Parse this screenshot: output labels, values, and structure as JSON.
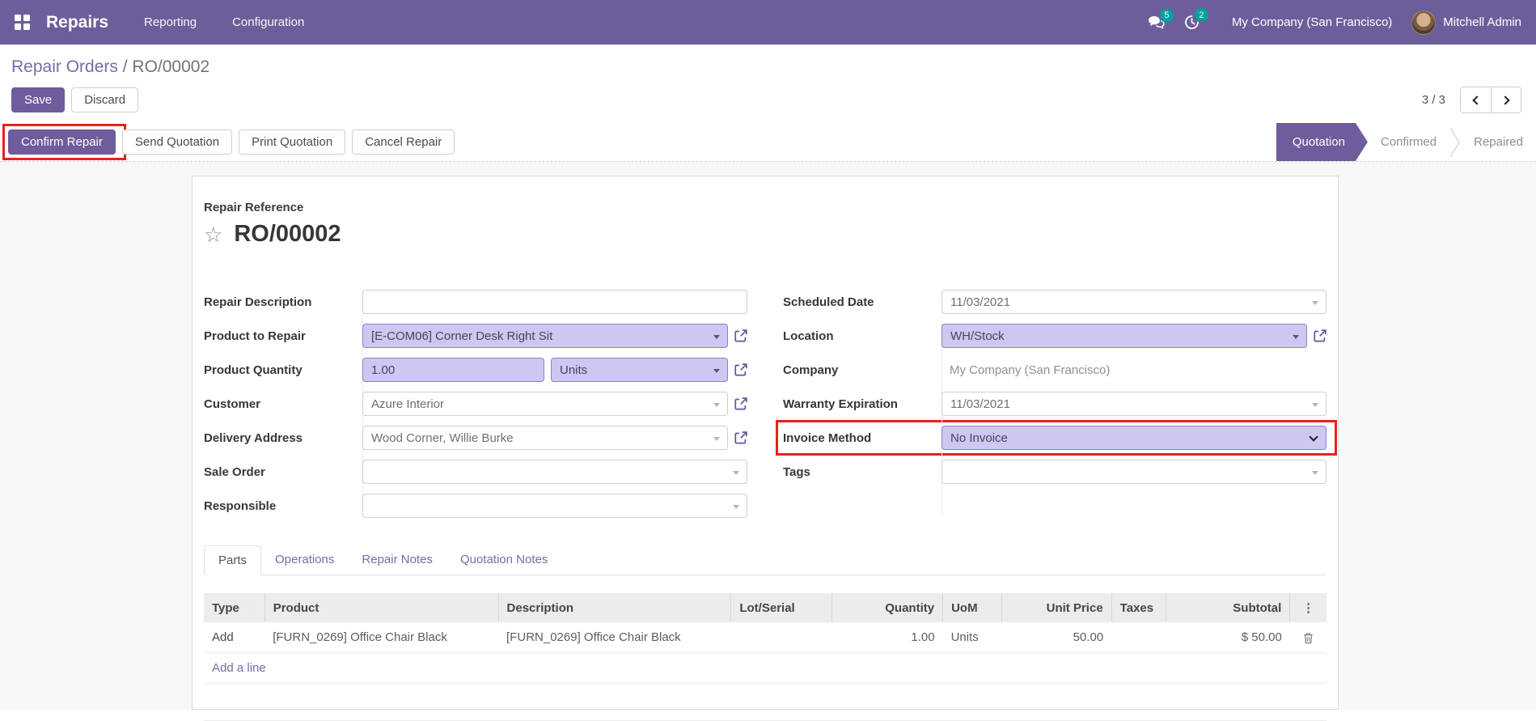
{
  "colors": {
    "navbar-bg": "#6d5e9b",
    "accent": "#6e5c9d",
    "accent-light": "#cdc7f2",
    "accent-border": "#8a80d0",
    "link": "#7a6aa8",
    "badge": "#00a09d",
    "highlight-red": "#e5231d"
  },
  "navbar": {
    "app_name": "Repairs",
    "menus": [
      {
        "label": "Reporting"
      },
      {
        "label": "Configuration"
      }
    ],
    "messages_badge": "5",
    "activities_badge": "2",
    "company_switcher": "My Company (San Francisco)",
    "user_name": "Mitchell Admin"
  },
  "breadcrumb": {
    "parent": "Repair Orders",
    "separator": "/",
    "current": "RO/00002"
  },
  "control_panel": {
    "save_label": "Save",
    "discard_label": "Discard",
    "pager": "3 / 3"
  },
  "statusbar": {
    "buttons": [
      {
        "label": "Confirm Repair"
      },
      {
        "label": "Send Quotation"
      },
      {
        "label": "Print Quotation"
      },
      {
        "label": "Cancel Repair"
      }
    ],
    "steps": [
      {
        "label": "Quotation",
        "active": true
      },
      {
        "label": "Confirmed",
        "active": false
      },
      {
        "label": "Repaired",
        "active": false
      }
    ]
  },
  "form": {
    "reference_label": "Repair Reference",
    "reference": "RO/00002",
    "star_icon": "☆",
    "fields": {
      "repair_description": {
        "label": "Repair Description",
        "value": ""
      },
      "product_to_repair": {
        "label": "Product to Repair",
        "value": "[E-COM06] Corner Desk Right Sit"
      },
      "product_quantity": {
        "label": "Product Quantity",
        "value": "1.00",
        "uom": "Units"
      },
      "customer": {
        "label": "Customer",
        "value": "Azure Interior"
      },
      "delivery_address": {
        "label": "Delivery Address",
        "value": "Wood Corner, Willie Burke"
      },
      "sale_order": {
        "label": "Sale Order",
        "value": ""
      },
      "responsible": {
        "label": "Responsible",
        "value": ""
      },
      "scheduled_date": {
        "label": "Scheduled Date",
        "value": "11/03/2021"
      },
      "location": {
        "label": "Location",
        "value": "WH/Stock"
      },
      "company": {
        "label": "Company",
        "value": "My Company (San Francisco)"
      },
      "warranty_expiration": {
        "label": "Warranty Expiration",
        "value": "11/03/2021"
      },
      "invoice_method": {
        "label": "Invoice Method",
        "value": "No Invoice"
      },
      "tags": {
        "label": "Tags",
        "value": ""
      }
    }
  },
  "tabs": [
    {
      "label": "Parts",
      "active": true
    },
    {
      "label": "Operations",
      "active": false
    },
    {
      "label": "Repair Notes",
      "active": false
    },
    {
      "label": "Quotation Notes",
      "active": false
    }
  ],
  "parts_table": {
    "columns": [
      "Type",
      "Product",
      "Description",
      "Lot/Serial",
      "Quantity",
      "UoM",
      "Unit Price",
      "Taxes",
      "Subtotal"
    ],
    "options_icon": "⋮",
    "rows": [
      {
        "type": "Add",
        "product": "[FURN_0269] Office Chair Black",
        "description": "[FURN_0269] Office Chair Black",
        "lot_serial": "",
        "quantity": "1.00",
        "uom": "Units",
        "unit_price": "50.00",
        "taxes": "",
        "subtotal": "$ 50.00"
      }
    ],
    "add_line_label": "Add a line"
  }
}
